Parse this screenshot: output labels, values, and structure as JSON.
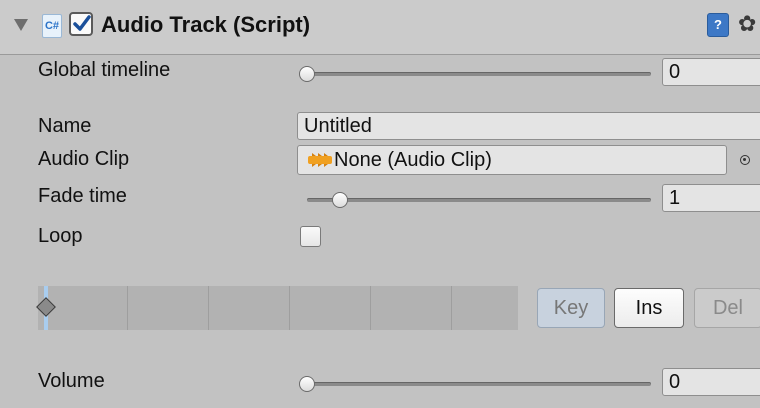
{
  "header": {
    "title": "Audio Track (Script)",
    "script_icon_text": "C#",
    "enabled": true,
    "help_icon_text": "?",
    "gear_icon_glyph": "✿"
  },
  "fields": {
    "global_timeline": {
      "label": "Global timeline",
      "value": "0",
      "slider_fraction": 0.0
    },
    "name": {
      "label": "Name",
      "value": "Untitled"
    },
    "audio_clip": {
      "label": "Audio Clip",
      "value": "None (Audio Clip)"
    },
    "fade_time": {
      "label": "Fade time",
      "value": "1",
      "slider_fraction": 0.1
    },
    "loop": {
      "label": "Loop",
      "checked": false
    },
    "volume": {
      "label": "Volume",
      "value": "0",
      "slider_fraction": 0.0
    }
  },
  "keyframe_buttons": {
    "key": "Key",
    "ins": "Ins",
    "del": "Del"
  },
  "colors": {
    "panel_bg": "#c2c2c2",
    "timeline_cursor": "#a9cdef",
    "help_icon": "#3d78c6",
    "audio_clip_icon": "#f0a020"
  }
}
